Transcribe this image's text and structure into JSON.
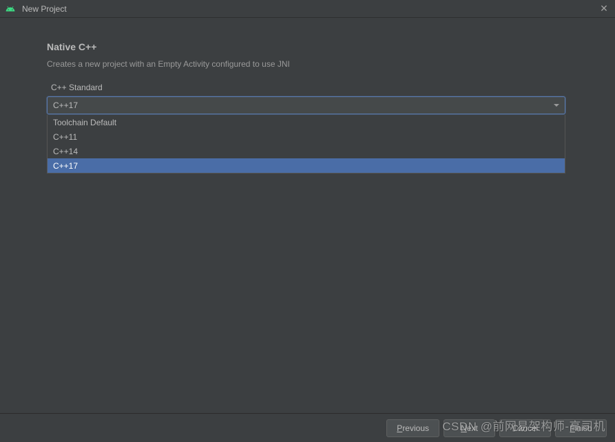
{
  "window": {
    "title": "New Project"
  },
  "page": {
    "heading": "Native C++",
    "description": "Creates a new project with an Empty Activity configured to use JNI",
    "field_label": "C++ Standard"
  },
  "dropdown": {
    "selected": "C++17",
    "options": [
      {
        "label": "Toolchain Default",
        "selected": false
      },
      {
        "label": "C++11",
        "selected": false
      },
      {
        "label": "C++14",
        "selected": false
      },
      {
        "label": "C++17",
        "selected": true
      }
    ]
  },
  "footer": {
    "previous": "Previous",
    "next": "Next",
    "cancel": "Cancel",
    "finish": "Finish"
  },
  "watermark": "CSDN @前网易架构师-高司机"
}
